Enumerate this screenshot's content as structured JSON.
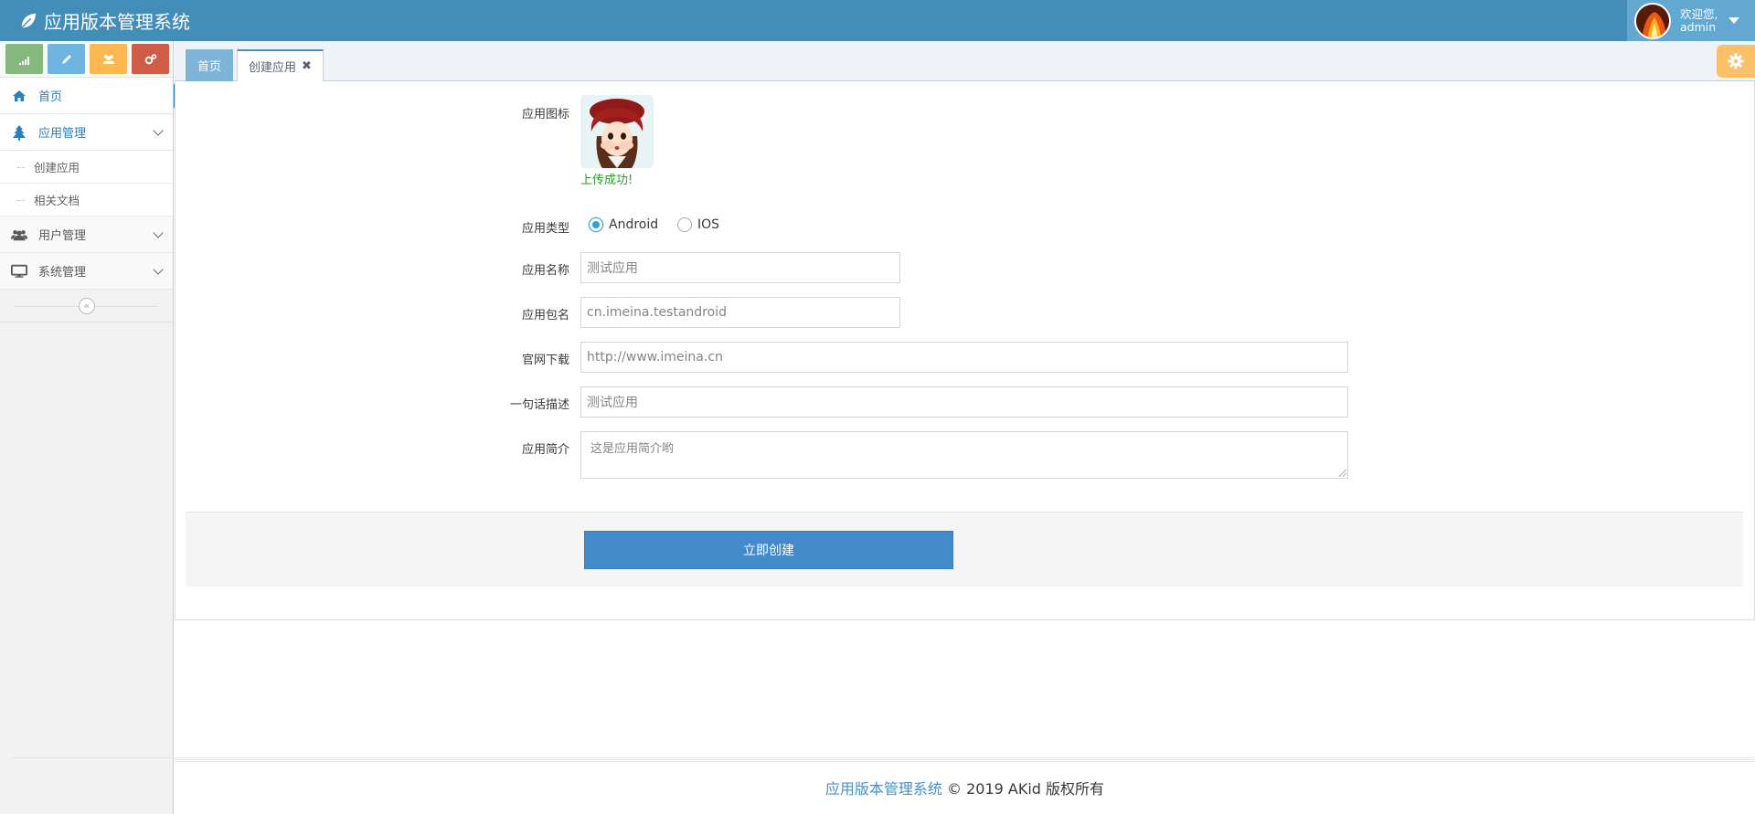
{
  "app": {
    "title": "应用版本管理系统",
    "welcome_line1": "欢迎您,",
    "welcome_line2": "admin"
  },
  "sidebar": {
    "shortcuts": [
      {
        "icon": "signal-icon",
        "color": "#87b87f"
      },
      {
        "icon": "pencil-icon",
        "color": "#6fb3e0"
      },
      {
        "icon": "group-icon",
        "color": "#ffb752"
      },
      {
        "icon": "cogs-icon",
        "color": "#d15b47"
      }
    ],
    "items": [
      {
        "label": "首页",
        "icon": "home-icon"
      },
      {
        "label": "应用管理",
        "icon": "tree-icon",
        "children": [
          {
            "label": "创建应用"
          },
          {
            "label": "相关文档"
          }
        ]
      },
      {
        "label": "用户管理",
        "icon": "users-icon"
      },
      {
        "label": "系统管理",
        "icon": "desktop-icon"
      }
    ],
    "collapse_glyph": "«"
  },
  "tabs": [
    {
      "label": "首页"
    },
    {
      "label": "创建应用",
      "close": "✖"
    }
  ],
  "form": {
    "icon_label": "应用图标",
    "upload_status": "上传成功!",
    "type_label": "应用类型",
    "type_options": [
      "Android",
      "IOS"
    ],
    "type_selected": "Android",
    "name_label": "应用名称",
    "name_value": "测试应用",
    "package_label": "应用包名",
    "package_value": "cn.imeina.testandroid",
    "download_label": "官网下载",
    "download_value": "http://www.imeina.cn",
    "slogan_label": "一句话描述",
    "slogan_value": "测试应用",
    "intro_label": "应用简介",
    "intro_value": "这是应用简介哟",
    "submit_label": "立即创建"
  },
  "footer": {
    "brand": "应用版本管理系统",
    "copyright": "© 2019   AKid   版权所有"
  },
  "colors": {
    "navbar": "#438eb9",
    "primary": "#428bca",
    "success": "#2a9d2a",
    "settings": "#ffb752"
  }
}
